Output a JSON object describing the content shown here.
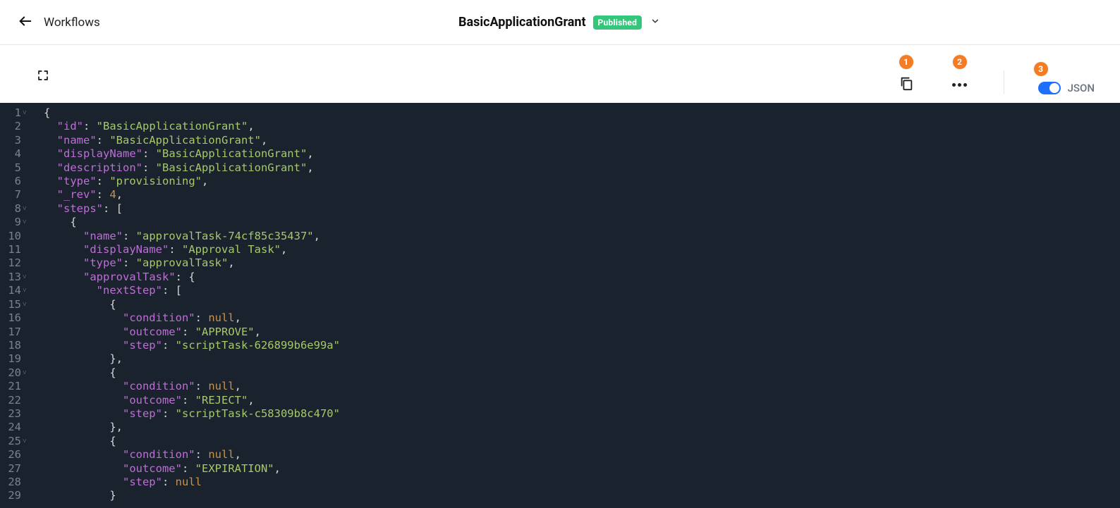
{
  "header": {
    "back_label": "Workflows",
    "title": "BasicApplicationGrant",
    "badge": "Published"
  },
  "annotations": {
    "a1": "1",
    "a2": "2",
    "a3": "3"
  },
  "toolbar": {
    "json_toggle_label": "JSON",
    "json_toggle_on": true
  },
  "editor": {
    "foldable_lines": [
      1,
      8,
      9,
      13,
      14,
      15,
      20,
      25
    ],
    "lines": [
      {
        "n": 1,
        "indent": 0,
        "tokens": [
          [
            "punc",
            "{"
          ]
        ]
      },
      {
        "n": 2,
        "indent": 1,
        "tokens": [
          [
            "key",
            "\"id\""
          ],
          [
            "punc",
            ": "
          ],
          [
            "str",
            "\"BasicApplicationGrant\""
          ],
          [
            "punc",
            ","
          ]
        ]
      },
      {
        "n": 3,
        "indent": 1,
        "tokens": [
          [
            "key",
            "\"name\""
          ],
          [
            "punc",
            ": "
          ],
          [
            "str",
            "\"BasicApplicationGrant\""
          ],
          [
            "punc",
            ","
          ]
        ]
      },
      {
        "n": 4,
        "indent": 1,
        "tokens": [
          [
            "key",
            "\"displayName\""
          ],
          [
            "punc",
            ": "
          ],
          [
            "str",
            "\"BasicApplicationGrant\""
          ],
          [
            "punc",
            ","
          ]
        ]
      },
      {
        "n": 5,
        "indent": 1,
        "tokens": [
          [
            "key",
            "\"description\""
          ],
          [
            "punc",
            ": "
          ],
          [
            "str",
            "\"BasicApplicationGrant\""
          ],
          [
            "punc",
            ","
          ]
        ]
      },
      {
        "n": 6,
        "indent": 1,
        "tokens": [
          [
            "key",
            "\"type\""
          ],
          [
            "punc",
            ": "
          ],
          [
            "str",
            "\"provisioning\""
          ],
          [
            "punc",
            ","
          ]
        ]
      },
      {
        "n": 7,
        "indent": 1,
        "tokens": [
          [
            "key",
            "\"_rev\""
          ],
          [
            "punc",
            ": "
          ],
          [
            "num",
            "4"
          ],
          [
            "punc",
            ","
          ]
        ]
      },
      {
        "n": 8,
        "indent": 1,
        "tokens": [
          [
            "key",
            "\"steps\""
          ],
          [
            "punc",
            ": ["
          ]
        ]
      },
      {
        "n": 9,
        "indent": 2,
        "tokens": [
          [
            "punc",
            "{"
          ]
        ]
      },
      {
        "n": 10,
        "indent": 3,
        "tokens": [
          [
            "key",
            "\"name\""
          ],
          [
            "punc",
            ": "
          ],
          [
            "str",
            "\"approvalTask-74cf85c35437\""
          ],
          [
            "punc",
            ","
          ]
        ]
      },
      {
        "n": 11,
        "indent": 3,
        "tokens": [
          [
            "key",
            "\"displayName\""
          ],
          [
            "punc",
            ": "
          ],
          [
            "str",
            "\"Approval Task\""
          ],
          [
            "punc",
            ","
          ]
        ]
      },
      {
        "n": 12,
        "indent": 3,
        "tokens": [
          [
            "key",
            "\"type\""
          ],
          [
            "punc",
            ": "
          ],
          [
            "str",
            "\"approvalTask\""
          ],
          [
            "punc",
            ","
          ]
        ]
      },
      {
        "n": 13,
        "indent": 3,
        "tokens": [
          [
            "key",
            "\"approvalTask\""
          ],
          [
            "punc",
            ": {"
          ]
        ]
      },
      {
        "n": 14,
        "indent": 4,
        "tokens": [
          [
            "key",
            "\"nextStep\""
          ],
          [
            "punc",
            ": ["
          ]
        ]
      },
      {
        "n": 15,
        "indent": 5,
        "tokens": [
          [
            "punc",
            "{"
          ]
        ]
      },
      {
        "n": 16,
        "indent": 6,
        "tokens": [
          [
            "key",
            "\"condition\""
          ],
          [
            "punc",
            ": "
          ],
          [
            "null",
            "null"
          ],
          [
            "punc",
            ","
          ]
        ]
      },
      {
        "n": 17,
        "indent": 6,
        "tokens": [
          [
            "key",
            "\"outcome\""
          ],
          [
            "punc",
            ": "
          ],
          [
            "str",
            "\"APPROVE\""
          ],
          [
            "punc",
            ","
          ]
        ]
      },
      {
        "n": 18,
        "indent": 6,
        "tokens": [
          [
            "key",
            "\"step\""
          ],
          [
            "punc",
            ": "
          ],
          [
            "str",
            "\"scriptTask-626899b6e99a\""
          ]
        ]
      },
      {
        "n": 19,
        "indent": 5,
        "tokens": [
          [
            "punc",
            "},"
          ]
        ]
      },
      {
        "n": 20,
        "indent": 5,
        "tokens": [
          [
            "punc",
            "{"
          ]
        ]
      },
      {
        "n": 21,
        "indent": 6,
        "tokens": [
          [
            "key",
            "\"condition\""
          ],
          [
            "punc",
            ": "
          ],
          [
            "null",
            "null"
          ],
          [
            "punc",
            ","
          ]
        ]
      },
      {
        "n": 22,
        "indent": 6,
        "tokens": [
          [
            "key",
            "\"outcome\""
          ],
          [
            "punc",
            ": "
          ],
          [
            "str",
            "\"REJECT\""
          ],
          [
            "punc",
            ","
          ]
        ]
      },
      {
        "n": 23,
        "indent": 6,
        "tokens": [
          [
            "key",
            "\"step\""
          ],
          [
            "punc",
            ": "
          ],
          [
            "str",
            "\"scriptTask-c58309b8c470\""
          ]
        ]
      },
      {
        "n": 24,
        "indent": 5,
        "tokens": [
          [
            "punc",
            "},"
          ]
        ]
      },
      {
        "n": 25,
        "indent": 5,
        "tokens": [
          [
            "punc",
            "{"
          ]
        ]
      },
      {
        "n": 26,
        "indent": 6,
        "tokens": [
          [
            "key",
            "\"condition\""
          ],
          [
            "punc",
            ": "
          ],
          [
            "null",
            "null"
          ],
          [
            "punc",
            ","
          ]
        ]
      },
      {
        "n": 27,
        "indent": 6,
        "tokens": [
          [
            "key",
            "\"outcome\""
          ],
          [
            "punc",
            ": "
          ],
          [
            "str",
            "\"EXPIRATION\""
          ],
          [
            "punc",
            ","
          ]
        ]
      },
      {
        "n": 28,
        "indent": 6,
        "tokens": [
          [
            "key",
            "\"step\""
          ],
          [
            "punc",
            ": "
          ],
          [
            "null",
            "null"
          ]
        ]
      },
      {
        "n": 29,
        "indent": 5,
        "tokens": [
          [
            "punc",
            "}"
          ]
        ]
      }
    ]
  }
}
